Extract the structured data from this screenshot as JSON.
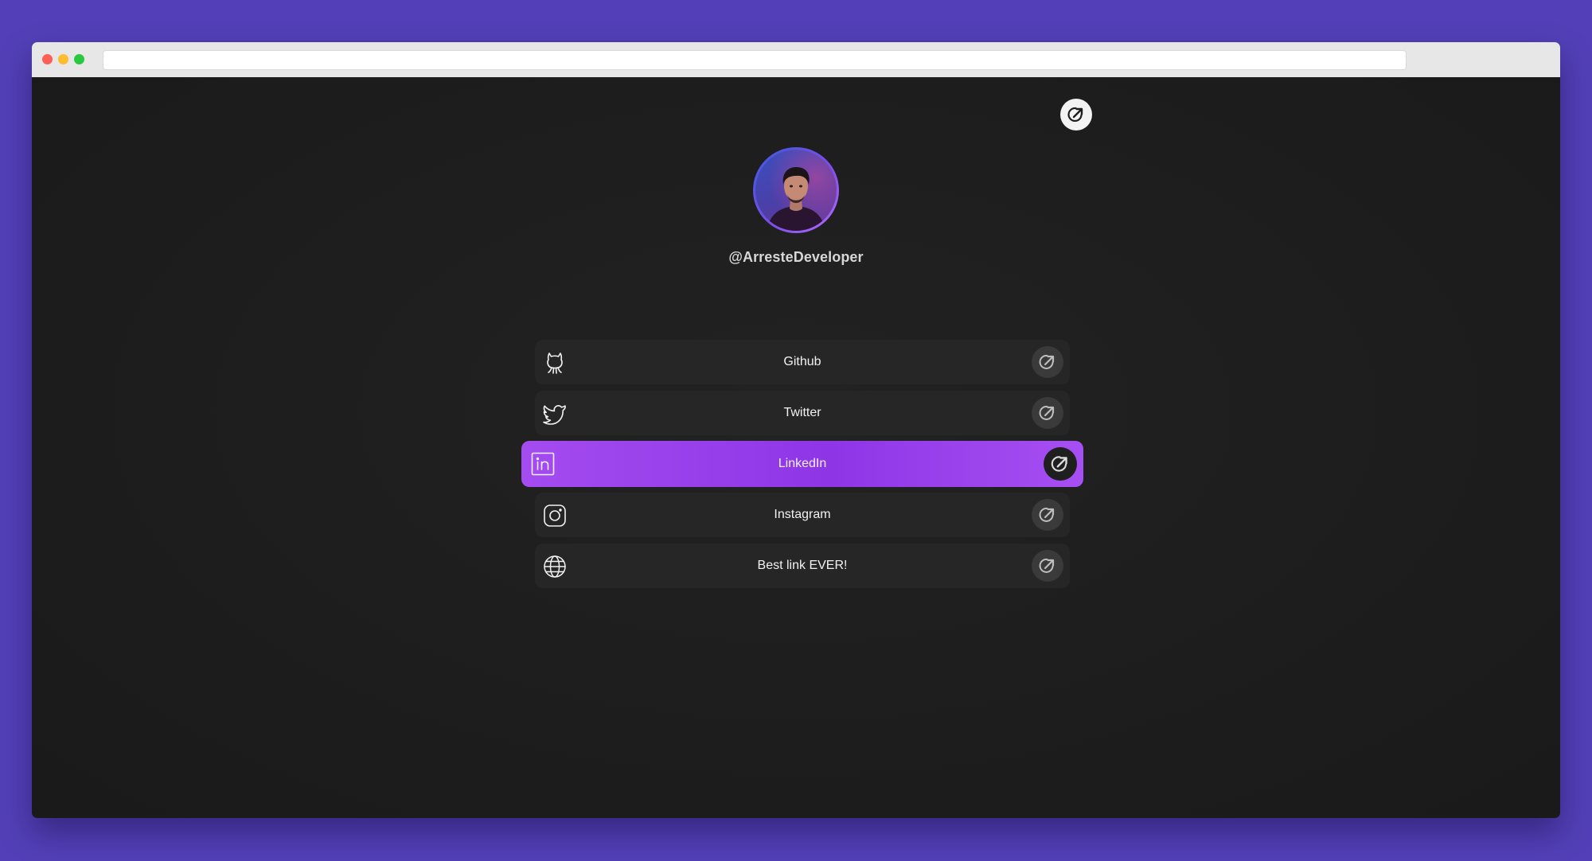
{
  "window": {
    "address_value": ""
  },
  "profile": {
    "username": "@ArresteDeveloper",
    "avatar_icon": "person-avatar"
  },
  "share_button": {
    "icon": "share-arrow-icon"
  },
  "links": [
    {
      "label": "Github",
      "icon": "github-icon",
      "active": false
    },
    {
      "label": "Twitter",
      "icon": "twitter-icon",
      "active": false
    },
    {
      "label": "LinkedIn",
      "icon": "linkedin-icon",
      "active": true
    },
    {
      "label": "Instagram",
      "icon": "instagram-icon",
      "active": false
    },
    {
      "label": "Best link EVER!",
      "icon": "globe-icon",
      "active": false
    }
  ],
  "colors": {
    "page_background": "#5340b8",
    "content_background": "#1d1d1d",
    "link_background": "#262626",
    "active_link_gradient_start": "#a44cf0",
    "active_link_gradient_end": "#8e36e6",
    "text": "#f2f2f2"
  }
}
